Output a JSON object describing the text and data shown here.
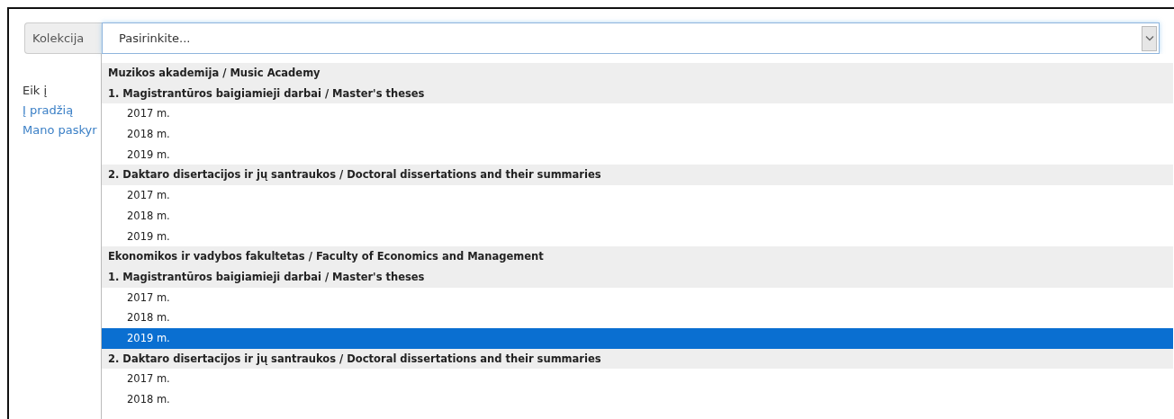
{
  "field": {
    "label": "Kolekcija",
    "placeholder": "Pasirinkite..."
  },
  "sidebar": {
    "heading": "Eik į",
    "links": [
      "Į pradžią",
      "Mano paskyr"
    ]
  },
  "dropdown": {
    "items": [
      {
        "kind": "group",
        "label": "Muzikos akademija / Music Academy",
        "selected": false
      },
      {
        "kind": "group",
        "label": "1. Magistrantūros baigiamieji darbai / Master's theses",
        "selected": false
      },
      {
        "kind": "option",
        "label": "2017 m.",
        "selected": false
      },
      {
        "kind": "option",
        "label": "2018 m.",
        "selected": false
      },
      {
        "kind": "option",
        "label": "2019 m.",
        "selected": false
      },
      {
        "kind": "group",
        "label": "2. Daktaro disertacijos ir jų santraukos / Doctoral dissertations and their summaries",
        "selected": false
      },
      {
        "kind": "option",
        "label": "2017 m.",
        "selected": false
      },
      {
        "kind": "option",
        "label": "2018 m.",
        "selected": false
      },
      {
        "kind": "option",
        "label": "2019 m.",
        "selected": false
      },
      {
        "kind": "group",
        "label": "Ekonomikos ir vadybos fakultetas / Faculty of Economics and Management",
        "selected": false
      },
      {
        "kind": "group",
        "label": "1. Magistrantūros baigiamieji darbai / Master's theses",
        "selected": false
      },
      {
        "kind": "option",
        "label": "2017 m.",
        "selected": false
      },
      {
        "kind": "option",
        "label": "2018 m.",
        "selected": false
      },
      {
        "kind": "option",
        "label": "2019 m.",
        "selected": true
      },
      {
        "kind": "group",
        "label": "2. Daktaro disertacijos ir jų santraukos / Doctoral dissertations and their summaries",
        "selected": false
      },
      {
        "kind": "option",
        "label": "2017 m.",
        "selected": false
      },
      {
        "kind": "option",
        "label": "2018 m.",
        "selected": false
      }
    ]
  }
}
